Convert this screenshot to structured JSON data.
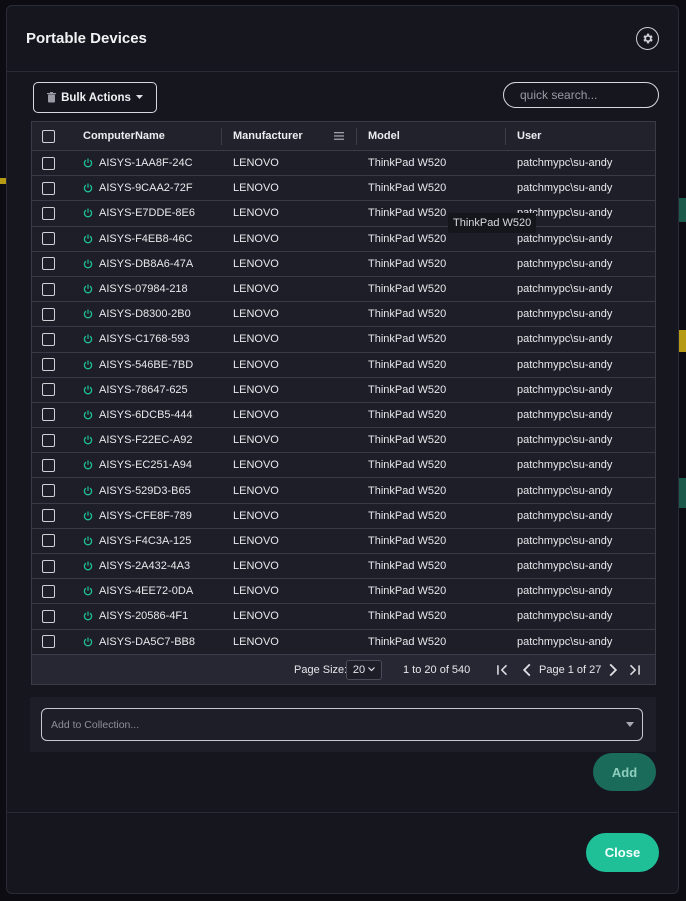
{
  "modal": {
    "title": "Portable Devices",
    "settings_icon": "gear-icon"
  },
  "toolbar": {
    "bulk_actions_label": "Bulk Actions",
    "search_placeholder": "quick search..."
  },
  "grid": {
    "columns": [
      "ComputerName",
      "Manufacturer",
      "Model",
      "User"
    ],
    "rows": [
      {
        "name": "AISYS-1AA8F-24C",
        "manufacturer": "LENOVO",
        "model": "ThinkPad W520",
        "user": "patchmypc\\su-andy"
      },
      {
        "name": "AISYS-9CAA2-72F",
        "manufacturer": "LENOVO",
        "model": "ThinkPad W520",
        "user": "patchmypc\\su-andy"
      },
      {
        "name": "AISYS-E7DDE-8E6",
        "manufacturer": "LENOVO",
        "model": "ThinkPad W520",
        "user": "patchmypc\\su-andy"
      },
      {
        "name": "AISYS-F4EB8-46C",
        "manufacturer": "LENOVO",
        "model": "ThinkPad W520",
        "user": "patchmypc\\su-andy"
      },
      {
        "name": "AISYS-DB8A6-47A",
        "manufacturer": "LENOVO",
        "model": "ThinkPad W520",
        "user": "patchmypc\\su-andy"
      },
      {
        "name": "AISYS-07984-218",
        "manufacturer": "LENOVO",
        "model": "ThinkPad W520",
        "user": "patchmypc\\su-andy"
      },
      {
        "name": "AISYS-D8300-2B0",
        "manufacturer": "LENOVO",
        "model": "ThinkPad W520",
        "user": "patchmypc\\su-andy"
      },
      {
        "name": "AISYS-C1768-593",
        "manufacturer": "LENOVO",
        "model": "ThinkPad W520",
        "user": "patchmypc\\su-andy"
      },
      {
        "name": "AISYS-546BE-7BD",
        "manufacturer": "LENOVO",
        "model": "ThinkPad W520",
        "user": "patchmypc\\su-andy"
      },
      {
        "name": "AISYS-78647-625",
        "manufacturer": "LENOVO",
        "model": "ThinkPad W520",
        "user": "patchmypc\\su-andy"
      },
      {
        "name": "AISYS-6DCB5-444",
        "manufacturer": "LENOVO",
        "model": "ThinkPad W520",
        "user": "patchmypc\\su-andy"
      },
      {
        "name": "AISYS-F22EC-A92",
        "manufacturer": "LENOVO",
        "model": "ThinkPad W520",
        "user": "patchmypc\\su-andy"
      },
      {
        "name": "AISYS-EC251-A94",
        "manufacturer": "LENOVO",
        "model": "ThinkPad W520",
        "user": "patchmypc\\su-andy"
      },
      {
        "name": "AISYS-529D3-B65",
        "manufacturer": "LENOVO",
        "model": "ThinkPad W520",
        "user": "patchmypc\\su-andy"
      },
      {
        "name": "AISYS-CFE8F-789",
        "manufacturer": "LENOVO",
        "model": "ThinkPad W520",
        "user": "patchmypc\\su-andy"
      },
      {
        "name": "AISYS-F4C3A-125",
        "manufacturer": "LENOVO",
        "model": "ThinkPad W520",
        "user": "patchmypc\\su-andy"
      },
      {
        "name": "AISYS-2A432-4A3",
        "manufacturer": "LENOVO",
        "model": "ThinkPad W520",
        "user": "patchmypc\\su-andy"
      },
      {
        "name": "AISYS-4EE72-0DA",
        "manufacturer": "LENOVO",
        "model": "ThinkPad W520",
        "user": "patchmypc\\su-andy"
      },
      {
        "name": "AISYS-20586-4F1",
        "manufacturer": "LENOVO",
        "model": "ThinkPad W520",
        "user": "patchmypc\\su-andy"
      },
      {
        "name": "AISYS-DA5C7-BB8",
        "manufacturer": "LENOVO",
        "model": "ThinkPad W520",
        "user": "patchmypc\\su-andy"
      }
    ],
    "tooltip": "ThinkPad W520",
    "status_icon": "power-icon",
    "status_color": "#1fbf98"
  },
  "pagination": {
    "page_size_label": "Page Size:",
    "page_size_value": "20",
    "range_text": "1 to 20 of 540",
    "page_text": "Page 1 of 27"
  },
  "collection": {
    "placeholder": "Add to Collection..."
  },
  "actions": {
    "add_label": "Add",
    "close_label": "Close"
  },
  "colors": {
    "accent": "#1fbf98",
    "accent_dim": "#1a6b5a",
    "background": "#16161f"
  }
}
